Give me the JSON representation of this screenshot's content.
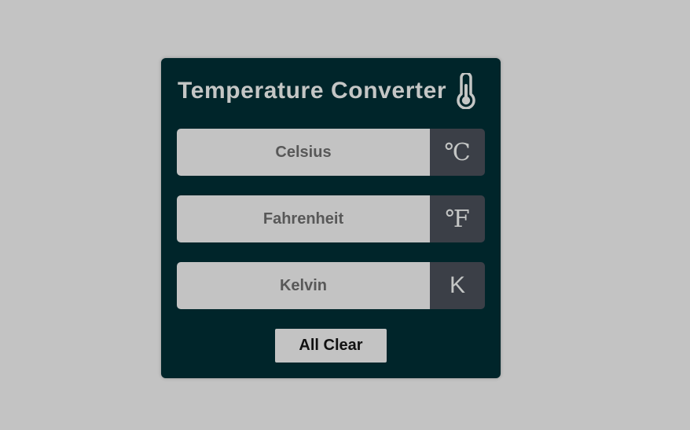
{
  "header": {
    "title": "Temperature Converter",
    "icon": "thermometer-icon"
  },
  "fields": [
    {
      "name": "celsius",
      "placeholder": "Celsius",
      "value": "",
      "unit": "℃"
    },
    {
      "name": "fahrenheit",
      "placeholder": "Fahrenheit",
      "value": "",
      "unit": "℉"
    },
    {
      "name": "kelvin",
      "placeholder": "Kelvin",
      "value": "",
      "unit": "K"
    }
  ],
  "actions": {
    "clear_label": "All Clear"
  },
  "colors": {
    "page_background": "#c3c3c3",
    "card_background": "#00252a",
    "input_background": "#c3c3c3",
    "unit_background": "#3b3f47",
    "title_text": "#c4c6c5"
  }
}
